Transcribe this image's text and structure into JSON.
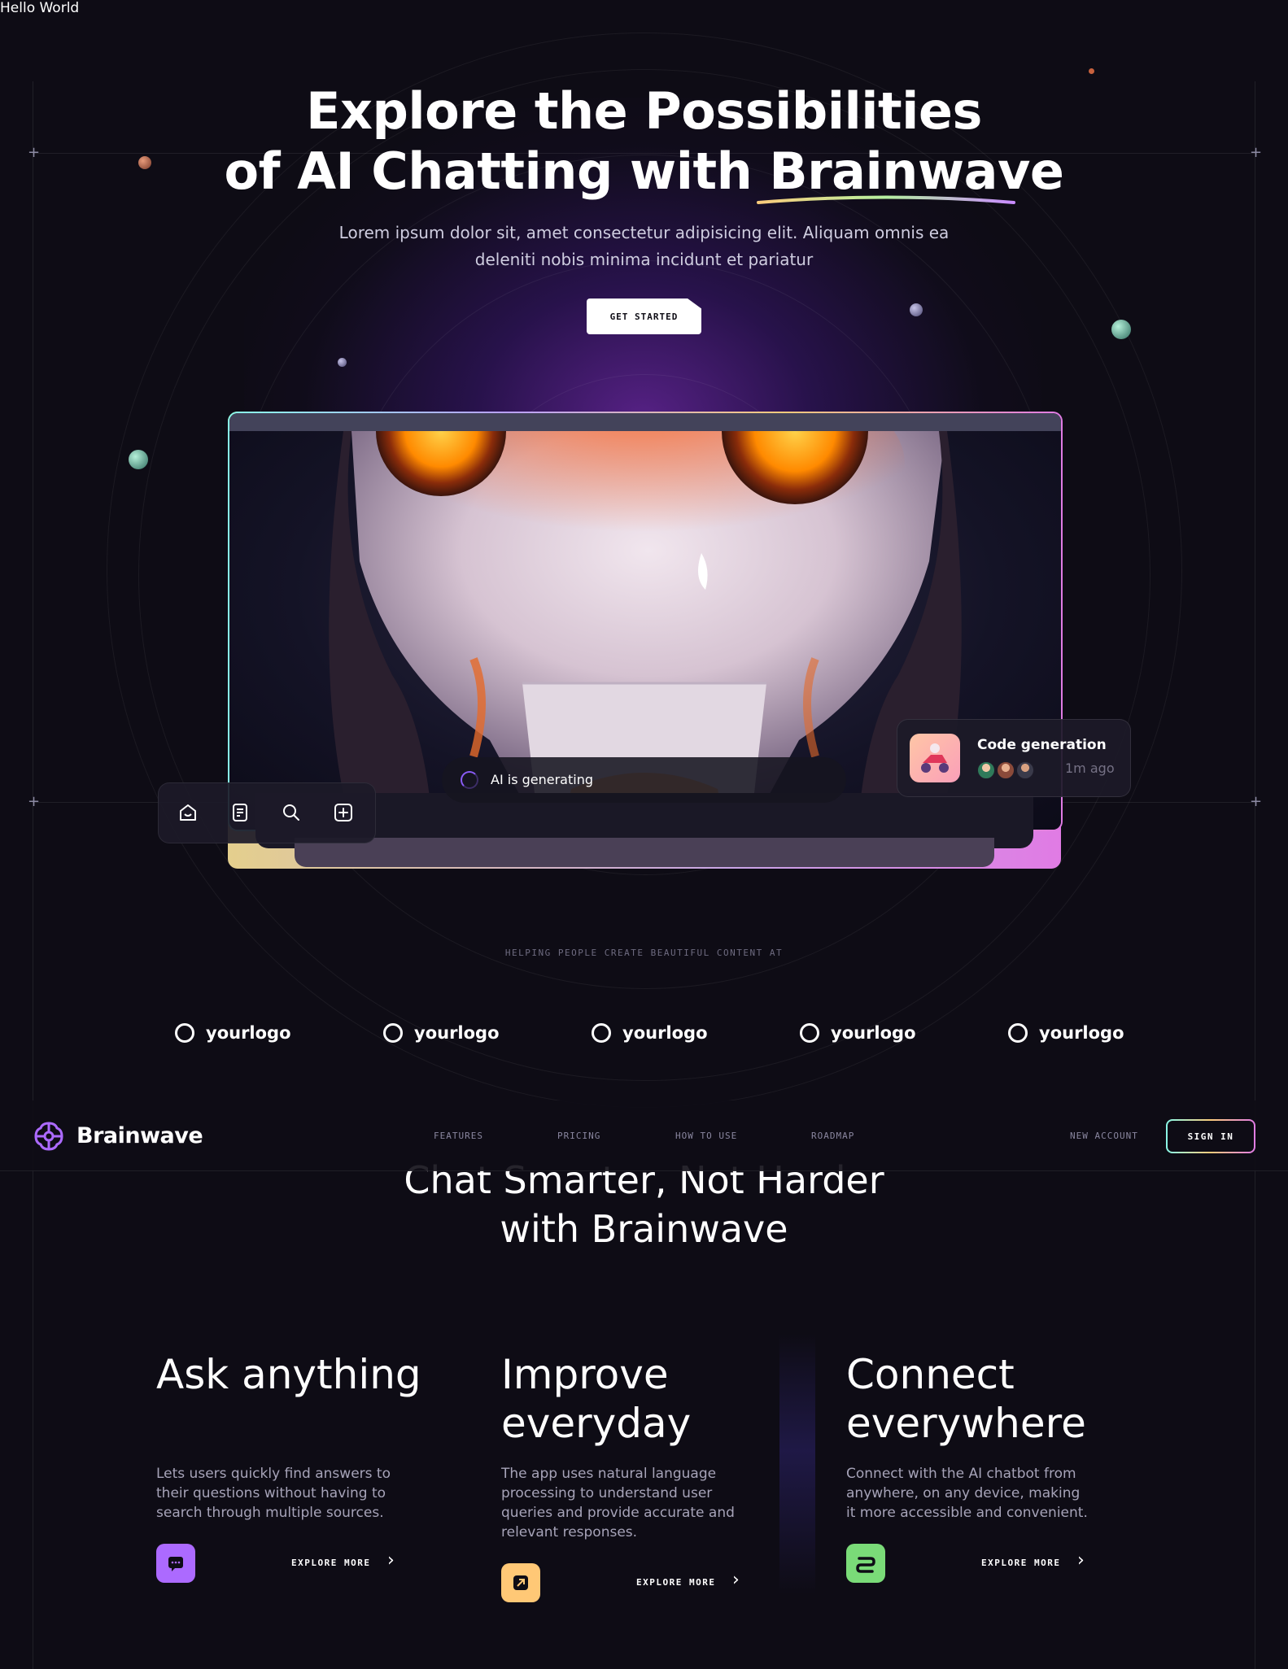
{
  "hello": "Hello World",
  "hero": {
    "title_line1": "Explore the Possibilities",
    "title_line2_prefix": "of AI Chatting with ",
    "title_accent": "Brainwave",
    "subtitle": "Lorem ipsum dolor sit, amet consectetur adipisicing elit. Aliquam omnis ea deleniti nobis minima incidunt et pariatur",
    "cta_label": "GET STARTED"
  },
  "generating": {
    "text": "AI is generating"
  },
  "toolbar": {
    "icons": [
      "home-icon",
      "document-icon",
      "search-icon",
      "add-square-icon"
    ]
  },
  "notification": {
    "title": "Code generation",
    "time": "1m ago"
  },
  "logos": {
    "heading": "HELPING PEOPLE CREATE BEAUTIFUL CONTENT AT",
    "items": [
      "yourlogo",
      "yourlogo",
      "yourlogo",
      "yourlogo",
      "yourlogo"
    ]
  },
  "header": {
    "brand": "Brainwave",
    "nav": [
      "FEATURES",
      "PRICING",
      "HOW TO USE",
      "ROADMAP"
    ],
    "new_account": "NEW ACCOUNT",
    "sign_in": "SIGN IN"
  },
  "section2": {
    "title_line1": "Chat Smarter, Not Harder",
    "title_line2": "with Brainwave"
  },
  "features": [
    {
      "title": "Ask anything",
      "text": "Lets users quickly find answers to their questions without having to search through multiple sources.",
      "cta": "EXPLORE MORE",
      "icon": "chat-icon",
      "color": "#ac6aff"
    },
    {
      "title": "Improve everyday",
      "text": "The app uses natural language processing to understand user queries and provide accurate and relevant responses.",
      "cta": "EXPLORE MORE",
      "icon": "expand-icon",
      "color": "#ffc876"
    },
    {
      "title": "Connect everywhere",
      "text": "Connect with the AI chatbot from anywhere, on any device, making it more accessible and convenient.",
      "cta": "EXPLORE MORE",
      "icon": "plug-icon",
      "color": "#7adb78"
    }
  ],
  "colors": {
    "background": "#0e0c15",
    "accent_purple": "#ac6aff",
    "accent_yellow": "#ffc876",
    "accent_green": "#7adb78",
    "accent_pink": "#e07be4"
  }
}
